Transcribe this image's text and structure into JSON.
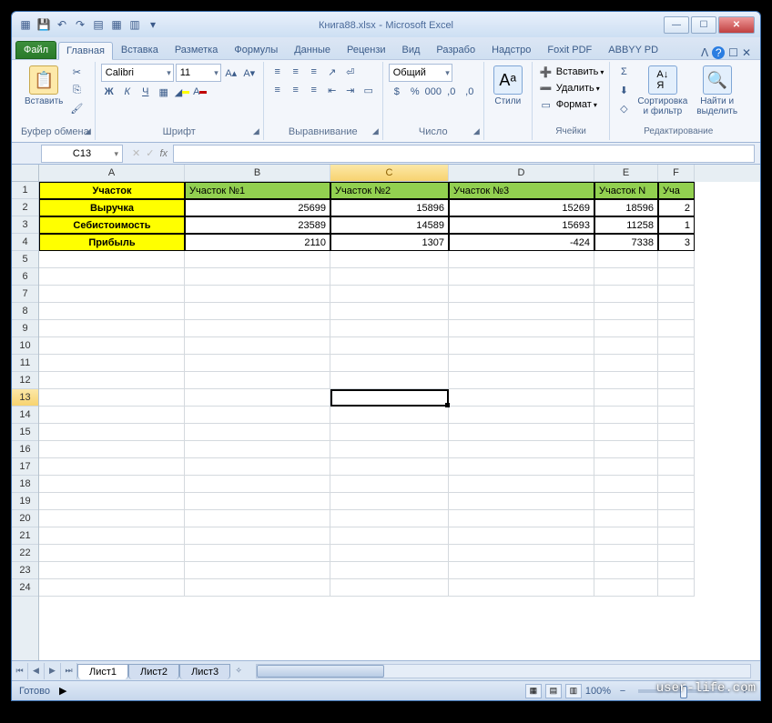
{
  "title_doc": "Книга88.xlsx",
  "title_app": "Microsoft Excel",
  "tabs": {
    "file": "Файл",
    "home": "Главная",
    "insert": "Вставка",
    "layout": "Разметка",
    "formulas": "Формулы",
    "data": "Данные",
    "review": "Рецензи",
    "view": "Вид",
    "dev": "Разрабо",
    "addins": "Надстро",
    "foxit": "Foxit PDF",
    "abbyy": "ABBYY PD"
  },
  "ribbon": {
    "clipboard": {
      "paste": "Вставить",
      "label": "Буфер обмена"
    },
    "font": {
      "name": "Calibri",
      "size": "11",
      "label": "Шрифт"
    },
    "align": {
      "label": "Выравнивание"
    },
    "number": {
      "format": "Общий",
      "label": "Число"
    },
    "styles": {
      "btn": "Стили"
    },
    "cells": {
      "insert": "Вставить",
      "delete": "Удалить",
      "format": "Формат",
      "label": "Ячейки"
    },
    "editing": {
      "sort": "Сортировка\nи фильтр",
      "find": "Найти и\nвыделить",
      "label": "Редактирование"
    }
  },
  "namebox": "C13",
  "columns": [
    {
      "id": "A",
      "w": 160
    },
    {
      "id": "B",
      "w": 160
    },
    {
      "id": "C",
      "w": 130
    },
    {
      "id": "D",
      "w": 160
    },
    {
      "id": "E",
      "w": 70
    },
    {
      "id": "F",
      "w": 40
    }
  ],
  "row_count": 24,
  "data": {
    "r1": [
      "Участок",
      "Участок №1",
      "Участок №2",
      "Участок №3",
      "Участок N",
      "Уча"
    ],
    "r2": [
      "Выручка",
      "25699",
      "15896",
      "15269",
      "18596",
      "2"
    ],
    "r3": [
      "Себистоимость",
      "23589",
      "14589",
      "15693",
      "11258",
      "1"
    ],
    "r4": [
      "Прибыль",
      "2110",
      "1307",
      "-424",
      "7338",
      "3"
    ]
  },
  "sheets": [
    "Лист1",
    "Лист2",
    "Лист3"
  ],
  "status": "Готово",
  "zoom": "100%",
  "watermark": "user-life.com",
  "chart_data": {
    "type": "table",
    "title": "Участок",
    "columns": [
      "Участок №1",
      "Участок №2",
      "Участок №3"
    ],
    "rows": [
      {
        "name": "Выручка",
        "values": [
          25699,
          15896,
          15269
        ]
      },
      {
        "name": "Себистоимость",
        "values": [
          23589,
          14589,
          15693
        ]
      },
      {
        "name": "Прибыль",
        "values": [
          2110,
          1307,
          -424
        ]
      }
    ]
  }
}
